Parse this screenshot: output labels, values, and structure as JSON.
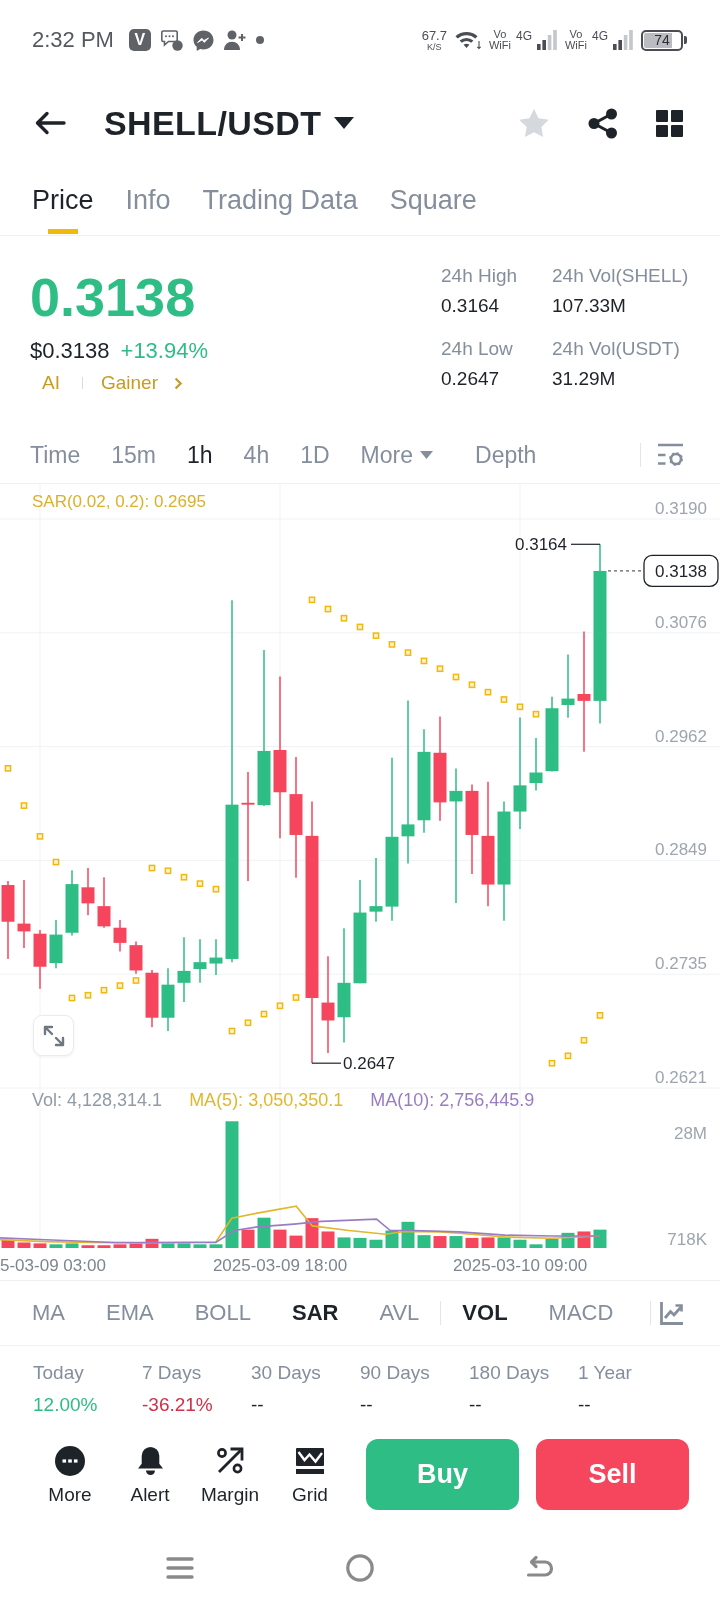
{
  "status_bar": {
    "time": "2:32 PM",
    "app_badge": "V",
    "net_speed": "67.7",
    "net_speed_unit": "K/S",
    "sims": [
      {
        "voice_top": "Vo",
        "voice_bottom": "WiFi",
        "network": "4G"
      },
      {
        "voice_top": "Vo",
        "voice_bottom": "WiFi",
        "network": "4G"
      }
    ],
    "battery": "74"
  },
  "header": {
    "pair": "SHELL/USDT",
    "favorite": false
  },
  "tabs": [
    {
      "label": "Price",
      "selected": true
    },
    {
      "label": "Info",
      "selected": false
    },
    {
      "label": "Trading Data",
      "selected": false
    },
    {
      "label": "Square",
      "selected": false
    }
  ],
  "price": {
    "last": "0.3138",
    "usd": "$0.3138",
    "change": "+13.94%",
    "rising": true,
    "tags": [
      "AI",
      "Gainer"
    ]
  },
  "stats": [
    {
      "label": "24h High",
      "value": "0.3164"
    },
    {
      "label": "24h Vol(SHELL)",
      "value": "107.33M"
    },
    {
      "label": "24h Low",
      "value": "0.2647"
    },
    {
      "label": "24h Vol(USDT)",
      "value": "31.29M"
    }
  ],
  "intervals": [
    {
      "label": "Time",
      "kind": "interval",
      "selected": false
    },
    {
      "label": "15m",
      "kind": "interval",
      "selected": false
    },
    {
      "label": "1h",
      "kind": "interval",
      "selected": true
    },
    {
      "label": "4h",
      "kind": "interval",
      "selected": false
    },
    {
      "label": "1D",
      "kind": "interval",
      "selected": false
    },
    {
      "label": "More",
      "kind": "dropdown",
      "selected": false
    },
    {
      "label": "Depth",
      "kind": "view",
      "selected": false
    }
  ],
  "chart": {
    "legend": "SAR(0.02, 0.2): 0.2695",
    "y_ticks": [
      "0.3190",
      "0.3076",
      "0.2962",
      "0.2849",
      "0.2735",
      "0.2621"
    ],
    "high_label": "0.3164",
    "low_label": "0.2647",
    "last_price": "0.3138"
  },
  "volume": {
    "legend": [
      {
        "label": "Vol: 4,128,314.1",
        "color": "#929aa5"
      },
      {
        "label": "MA(5): 3,050,350.1",
        "color": "#e2b72c"
      },
      {
        "label": "MA(10): 2,756,445.9",
        "color": "#9a7cc4"
      }
    ],
    "y_ticks": [
      "28M",
      "718K"
    ],
    "x_labels": [
      "5-03-09 03:00",
      "2025-03-09 18:00",
      "2025-03-10 09:00"
    ]
  },
  "main_indicators": [
    {
      "label": "MA",
      "selected": false
    },
    {
      "label": "EMA",
      "selected": false
    },
    {
      "label": "BOLL",
      "selected": false
    },
    {
      "label": "SAR",
      "selected": true
    },
    {
      "label": "AVL",
      "selected": false
    }
  ],
  "sub_indicators": [
    {
      "label": "VOL",
      "selected": true
    },
    {
      "label": "MACD",
      "selected": false
    }
  ],
  "performance": [
    {
      "label": "Today",
      "value": "12.00%",
      "color": "#2ebd85"
    },
    {
      "label": "7 Days",
      "value": "-36.21%",
      "color": "#cf304a"
    },
    {
      "label": "30 Days",
      "value": "--",
      "color": "#1e2329"
    },
    {
      "label": "90 Days",
      "value": "--",
      "color": "#1e2329"
    },
    {
      "label": "180 Days",
      "value": "--",
      "color": "#1e2329"
    },
    {
      "label": "1 Year",
      "value": "--",
      "color": "#1e2329"
    }
  ],
  "actions": [
    {
      "label": "More",
      "kind": "more"
    },
    {
      "label": "Alert",
      "kind": "alert"
    },
    {
      "label": "Margin",
      "kind": "margin"
    },
    {
      "label": "Grid",
      "kind": "grid"
    }
  ],
  "trade_buttons": [
    {
      "label": "Buy",
      "kind": "buy"
    },
    {
      "label": "Sell",
      "kind": "sell"
    }
  ]
}
